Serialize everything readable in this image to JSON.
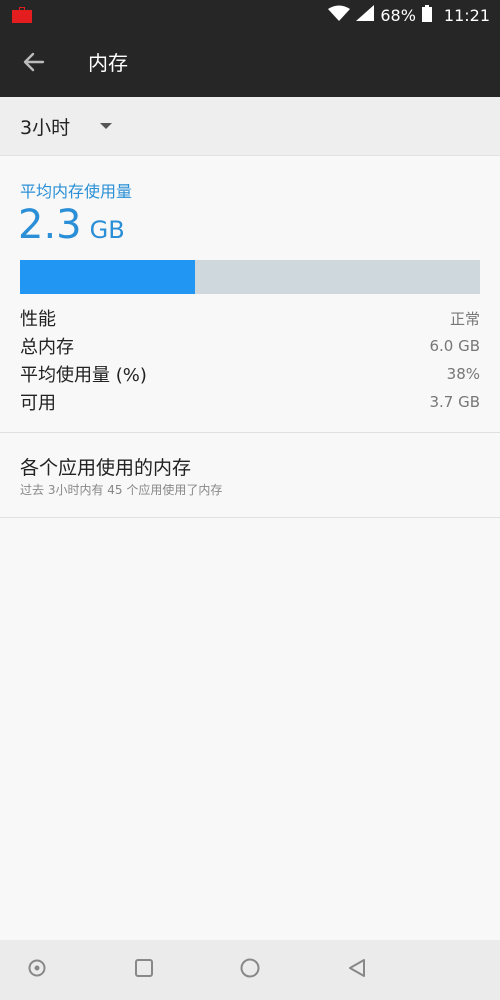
{
  "status_bar": {
    "battery": "68%",
    "time": "11:21",
    "icons": [
      "briefcase-icon",
      "wifi-icon",
      "cell-signal-icon",
      "battery-icon"
    ]
  },
  "app_bar": {
    "title": "内存",
    "back_icon": "arrow-left-icon"
  },
  "time_range": {
    "selected": "3小时"
  },
  "summary": {
    "heading": "平均内存使用量",
    "average_value": "2.3",
    "average_unit": "GB",
    "usage_fraction": 0.38,
    "colors": {
      "accent": "#2a8fd6",
      "bar_fill": "#2196f3",
      "bar_track": "#cfd8dc"
    },
    "stats": [
      {
        "label": "性能",
        "value": "正常"
      },
      {
        "label": "总内存",
        "value": "6.0 GB"
      },
      {
        "label": "平均使用量 (%)",
        "value": "38%"
      },
      {
        "label": "可用",
        "value": "3.7 GB"
      }
    ]
  },
  "app_memory": {
    "title": "各个应用使用的内存",
    "subtitle": "过去 3小时内有 45 个应用使用了内存"
  },
  "nav_bar": {
    "icons": [
      "assist-dot-icon",
      "recents-square-icon",
      "home-circle-icon",
      "back-triangle-icon"
    ]
  }
}
